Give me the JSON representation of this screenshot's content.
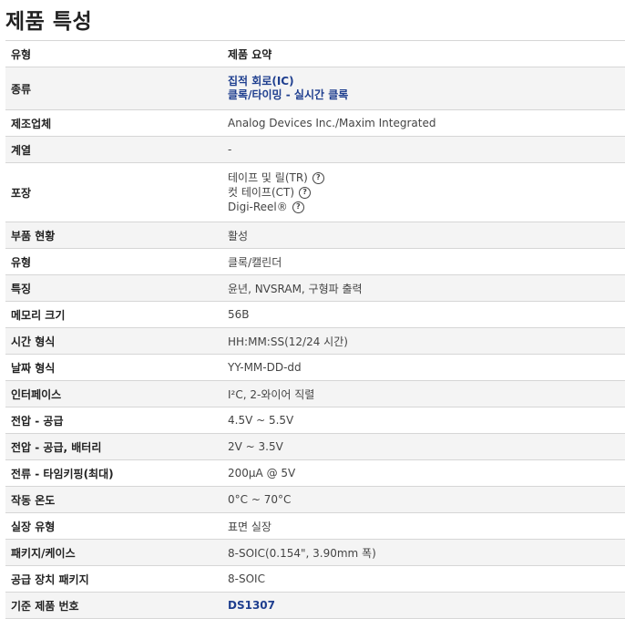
{
  "title": "제품 특성",
  "header": {
    "key": "유형",
    "value": "제품 요약"
  },
  "rows": [
    {
      "key": "종류",
      "links": [
        "집적 회로(IC)",
        "클록/타이밍 - 실시간 클록"
      ]
    },
    {
      "key": "제조업체",
      "value": "Analog Devices Inc./Maxim Integrated"
    },
    {
      "key": "계열",
      "value": "-"
    },
    {
      "key": "포장",
      "lines": [
        "테이프 및 릴(TR)",
        "컷 테이프(CT)",
        "Digi-Reel®"
      ],
      "help_icon": "question-circle-icon"
    },
    {
      "key": "부품 현황",
      "value": "활성"
    },
    {
      "key": "유형",
      "value": "클록/캘린더"
    },
    {
      "key": "특징",
      "value": "윤년, NVSRAM, 구형파 출력"
    },
    {
      "key": "메모리 크기",
      "value": "56B"
    },
    {
      "key": "시간 형식",
      "value": "HH:MM:SS(12/24 시간)"
    },
    {
      "key": "날짜 형식",
      "value": "YY-MM-DD-dd"
    },
    {
      "key": "인터페이스",
      "value": "I²C, 2-와이어 직렬"
    },
    {
      "key": "전압 - 공급",
      "value": "4.5V ~ 5.5V"
    },
    {
      "key": "전압 - 공급, 배터리",
      "value": "2V ~ 3.5V"
    },
    {
      "key": "전류 - 타임키핑(최대)",
      "value": "200µA @ 5V"
    },
    {
      "key": "작동 온도",
      "value": "0°C ~ 70°C"
    },
    {
      "key": "실장 유형",
      "value": "표면 실장"
    },
    {
      "key": "패키지/케이스",
      "value": "8-SOIC(0.154\", 3.90mm 폭)"
    },
    {
      "key": "공급 장치 패키지",
      "value": "8-SOIC"
    },
    {
      "key": "기준 제품 번호",
      "link": "DS1307"
    }
  ]
}
